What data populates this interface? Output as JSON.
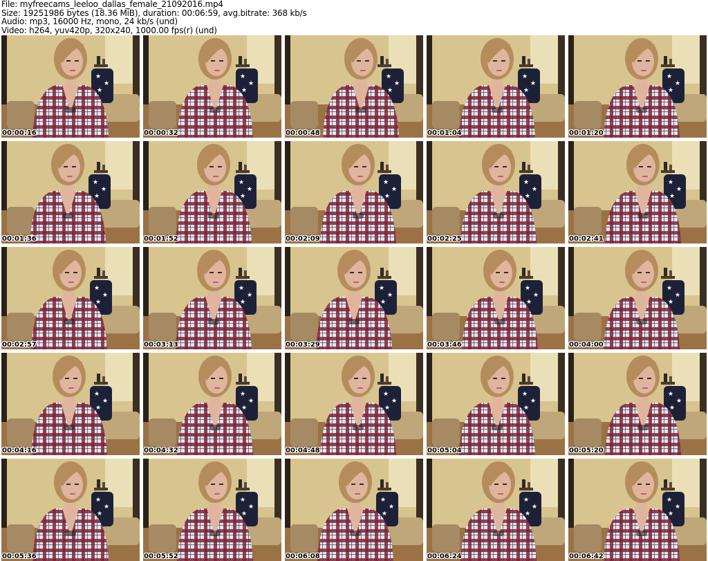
{
  "header": {
    "file_line": "File: myfreecams_leeloo_dallas_female_21092016.mp4",
    "size_line": "Size: 19251986 bytes (18.36 MiB), duration: 00:06:59, avg.bitrate: 368 kb/s",
    "audio_line": "Audio: mp3, 16000 Hz, mono, 24 kb/s (und)",
    "video_line": "Video: h264, yuv420p, 320x240, 1000.00 fps(r) (und)"
  },
  "thumbnails": [
    {
      "timestamp": "00:00:16"
    },
    {
      "timestamp": "00:00:32"
    },
    {
      "timestamp": "00:00:48"
    },
    {
      "timestamp": "00:01:04"
    },
    {
      "timestamp": "00:01:20"
    },
    {
      "timestamp": "00:01:36"
    },
    {
      "timestamp": "00:01:52"
    },
    {
      "timestamp": "00:02:09"
    },
    {
      "timestamp": "00:02:25"
    },
    {
      "timestamp": "00:02:41"
    },
    {
      "timestamp": "00:02:57"
    },
    {
      "timestamp": "00:03:13"
    },
    {
      "timestamp": "00:03:29"
    },
    {
      "timestamp": "00:03:46"
    },
    {
      "timestamp": "00:04:00"
    },
    {
      "timestamp": "00:04:16"
    },
    {
      "timestamp": "00:04:32"
    },
    {
      "timestamp": "00:04:48"
    },
    {
      "timestamp": "00:05:04"
    },
    {
      "timestamp": "00:05:20"
    },
    {
      "timestamp": "00:05:36"
    },
    {
      "timestamp": "00:05:52"
    },
    {
      "timestamp": "00:06:08"
    },
    {
      "timestamp": "00:06:24"
    },
    {
      "timestamp": "00:06:42"
    }
  ],
  "colors": {
    "wall": "#d8c48f",
    "floor": "#9b7246",
    "shirt_red": "#7e2436",
    "shirt_light": "#e9e4ea",
    "hair": "#b58d5c",
    "skin": "#e0b59e",
    "pillow": "#1d2138"
  }
}
